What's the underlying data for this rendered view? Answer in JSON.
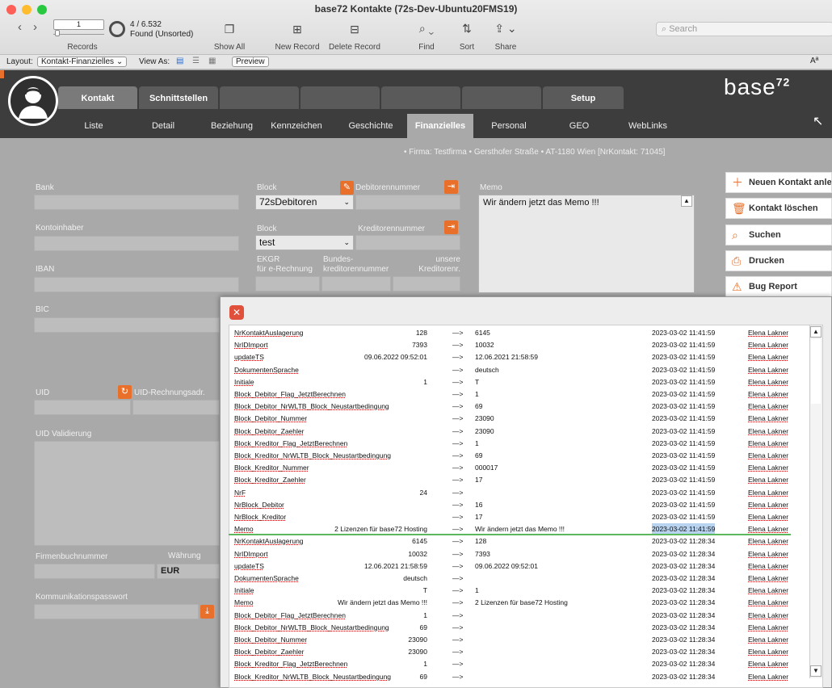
{
  "window": {
    "title": "base72 Kontakte (72s-Dev-Ubuntu20FMS19)"
  },
  "toolbar": {
    "record_current": "1",
    "records_found": "4 / 6.532",
    "found_state": "Found (Unsorted)",
    "records_label": "Records",
    "show_all": "Show All",
    "new_record": "New Record",
    "delete_record": "Delete Record",
    "find": "Find",
    "sort": "Sort",
    "share": "Share",
    "search_placeholder": "Search"
  },
  "layoutbar": {
    "layout_label": "Layout:",
    "layout_value": "Kontakt-Finanzielles",
    "view_as": "View As:",
    "preview": "Preview",
    "font_icon": "Aª"
  },
  "main_tabs": [
    "Kontakt",
    "Schnittstellen",
    "",
    "",
    "",
    "",
    "Setup"
  ],
  "sub_tabs": [
    "Liste",
    "Detail",
    "Beziehung",
    "Kennzeichen",
    "Geschichte",
    "Finanzielles",
    "Personal",
    "GEO",
    "WebLinks"
  ],
  "logo": {
    "text": "base",
    "sup": "72"
  },
  "firma": "• Firma: Testfirma • Gersthofer Straße • AT-1180 Wien [NrKontakt: 71045]",
  "form": {
    "bank": "Bank",
    "kontoinhaber": "Kontoinhaber",
    "iban": "IBAN",
    "bic": "BIC",
    "uid": "UID",
    "uid_rechnung": "UID-Rechnungsadr.",
    "uid_validierung": "UID Validierung",
    "firmenbuchnummer": "Firmenbuchnummer",
    "waehrung": "Währung",
    "waehrung_value": "EUR",
    "kommunikationspasswort": "Kommunikationspasswort",
    "block": "Block",
    "block1_value": "72sDebitoren",
    "debitorennummer": "Debitorennummer",
    "block2_value": "test",
    "kreditorennummer": "Kreditorennummer",
    "ekgr": "EKGR",
    "ekgr2": "für e-Rechnung",
    "bundes": "Bundes-",
    "bundes2": "kreditorennummer",
    "unsere": "unsere",
    "unsere2": "Kreditorenr.",
    "memo": "Memo",
    "memo_value": "Wir ändern jetzt das Memo !!!"
  },
  "actions": [
    "Neuen Kontakt anlegen",
    "Kontakt löschen",
    "Suchen",
    "Drucken",
    "Bug Report"
  ],
  "log_rows": [
    [
      "NrKontaktAuslagerung",
      "128",
      "—>",
      "6145",
      "2023-03-02 11:41:59",
      "Elena Lakner"
    ],
    [
      "NrIDImport",
      "7393",
      "—>",
      "10032",
      "2023-03-02 11:41:59",
      "Elena Lakner"
    ],
    [
      "updateTS",
      "09.06.2022 09:52:01",
      "—>",
      "12.06.2021 21:58:59",
      "2023-03-02 11:41:59",
      "Elena Lakner"
    ],
    [
      "DokumentenSprache",
      "",
      "—>",
      "deutsch",
      "2023-03-02 11:41:59",
      "Elena Lakner"
    ],
    [
      "Initiale",
      "1",
      "—>",
      "T",
      "2023-03-02 11:41:59",
      "Elena Lakner"
    ],
    [
      "Block_Debitor_Flag_JetztBerechnen",
      "",
      "—>",
      "1",
      "2023-03-02 11:41:59",
      "Elena Lakner"
    ],
    [
      "Block_Debitor_NrWLTB_Block_Neustartbedingung",
      "",
      "—>",
      "69",
      "2023-03-02 11:41:59",
      "Elena Lakner"
    ],
    [
      "Block_Debitor_Nummer",
      "",
      "—>",
      "23090",
      "2023-03-02 11:41:59",
      "Elena Lakner"
    ],
    [
      "Block_Debitor_Zaehler",
      "",
      "—>",
      "23090",
      "2023-03-02 11:41:59",
      "Elena Lakner"
    ],
    [
      "Block_Kreditor_Flag_JetztBerechnen",
      "",
      "—>",
      "1",
      "2023-03-02 11:41:59",
      "Elena Lakner"
    ],
    [
      "Block_Kreditor_NrWLTB_Block_Neustartbedingung",
      "",
      "—>",
      "69",
      "2023-03-02 11:41:59",
      "Elena Lakner"
    ],
    [
      "Block_Kreditor_Nummer",
      "",
      "—>",
      "000017",
      "2023-03-02 11:41:59",
      "Elena Lakner"
    ],
    [
      "Block_Kreditor_Zaehler",
      "",
      "—>",
      "17",
      "2023-03-02 11:41:59",
      "Elena Lakner"
    ],
    [
      "NrF",
      "24",
      "—>",
      "",
      "2023-03-02 11:41:59",
      "Elena Lakner"
    ],
    [
      "NrBlock_Debitor",
      "",
      "—>",
      "16",
      "2023-03-02 11:41:59",
      "Elena Lakner"
    ],
    [
      "NrBlock_Kreditor",
      "",
      "—>",
      "17",
      "2023-03-02 11:41:59",
      "Elena Lakner"
    ],
    [
      "Memo",
      "2 Lizenzen für base72 Hosting",
      "—>",
      "Wir ändern jetzt das Memo !!!",
      "2023-03-02 11:41:59",
      "Elena Lakner"
    ],
    [
      "NrKontaktAuslagerung",
      "6145",
      "—>",
      "128",
      "2023-03-02 11:28:34",
      "Elena Lakner"
    ],
    [
      "NrIDImport",
      "10032",
      "—>",
      "7393",
      "2023-03-02 11:28:34",
      "Elena Lakner"
    ],
    [
      "updateTS",
      "12.06.2021 21:58:59",
      "—>",
      "09.06.2022 09:52:01",
      "2023-03-02 11:28:34",
      "Elena Lakner"
    ],
    [
      "DokumentenSprache",
      "deutsch",
      "—>",
      "",
      "2023-03-02 11:28:34",
      "Elena Lakner"
    ],
    [
      "Initiale",
      "T",
      "—>",
      "1",
      "2023-03-02 11:28:34",
      "Elena Lakner"
    ],
    [
      "Memo",
      "Wir ändern jetzt das Memo !!!",
      "—>",
      "2 Lizenzen für base72 Hosting",
      "2023-03-02 11:28:34",
      "Elena Lakner"
    ],
    [
      "Block_Debitor_Flag_JetztBerechnen",
      "1",
      "—>",
      "",
      "2023-03-02 11:28:34",
      "Elena Lakner"
    ],
    [
      "Block_Debitor_NrWLTB_Block_Neustartbedingung",
      "69",
      "—>",
      "",
      "2023-03-02 11:28:34",
      "Elena Lakner"
    ],
    [
      "Block_Debitor_Nummer",
      "23090",
      "—>",
      "",
      "2023-03-02 11:28:34",
      "Elena Lakner"
    ],
    [
      "Block_Debitor_Zaehler",
      "23090",
      "—>",
      "",
      "2023-03-02 11:28:34",
      "Elena Lakner"
    ],
    [
      "Block_Kreditor_Flag_JetztBerechnen",
      "1",
      "—>",
      "",
      "2023-03-02 11:28:34",
      "Elena Lakner"
    ],
    [
      "Block_Kreditor_NrWLTB_Block_Neustartbedingung",
      "69",
      "—>",
      "",
      "2023-03-02 11:28:34",
      "Elena Lakner"
    ]
  ],
  "colors": {
    "accent": "#e8702b",
    "header": "#3d3d3d",
    "highlight": "#b8d3ef",
    "separator": "#5cb85c"
  }
}
